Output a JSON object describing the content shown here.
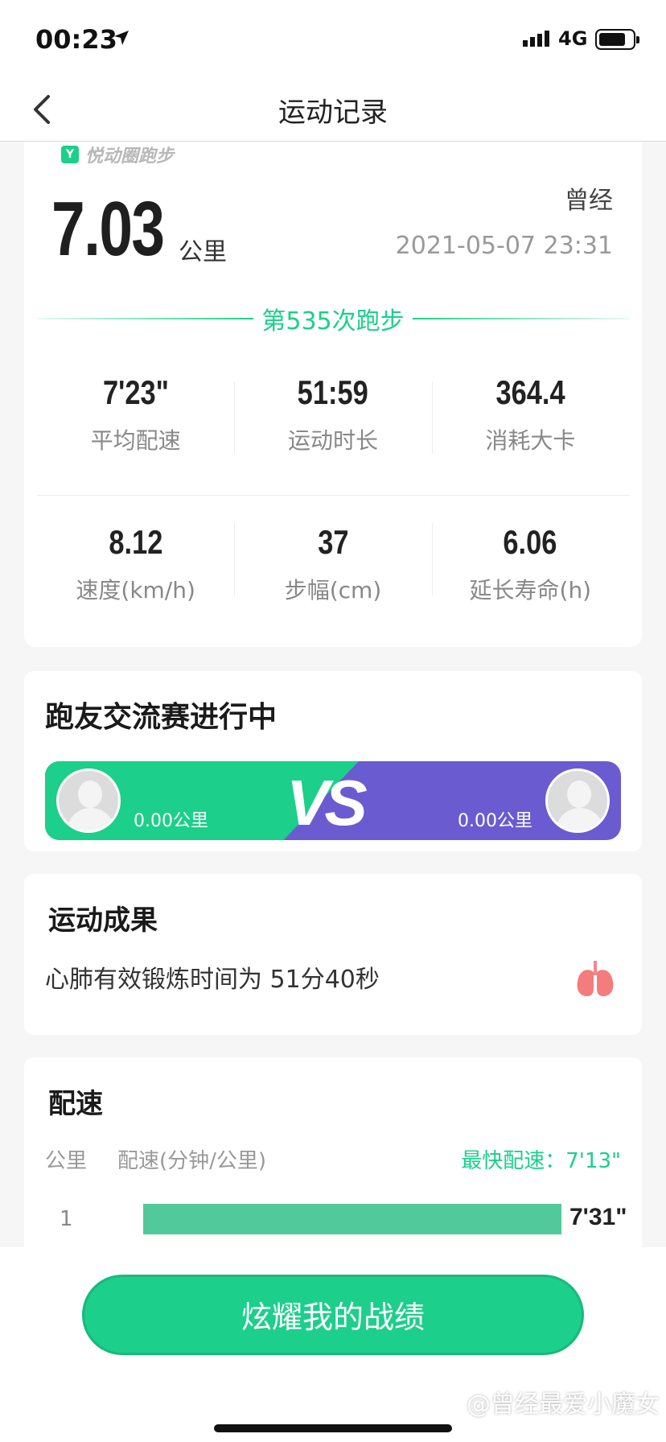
{
  "status_bar": {
    "time": "00:23",
    "network": "4G"
  },
  "nav": {
    "title": "运动记录"
  },
  "summary": {
    "brand": "悦动圈跑步",
    "nickname": "曾经",
    "distance": "7.03",
    "distance_unit": "公里",
    "datetime": "2021-05-07 23:31",
    "run_count_label": "第535次跑步",
    "stats": [
      {
        "value": "7'23\"",
        "label": "平均配速"
      },
      {
        "value": "51:59",
        "label": "运动时长"
      },
      {
        "value": "364.4",
        "label": "消耗大卡"
      },
      {
        "value": "8.12",
        "label": "速度(km/h)"
      },
      {
        "value": "37",
        "label": "步幅(cm)"
      },
      {
        "value": "6.06",
        "label": "延长寿命(h)"
      }
    ]
  },
  "match": {
    "title": "跑友交流赛进行中",
    "vs": "VS",
    "left_distance": "0.00公里",
    "right_distance": "0.00公里"
  },
  "result": {
    "title": "运动成果",
    "text": "心肺有效锻炼时间为 51分40秒"
  },
  "pace": {
    "title": "配速",
    "col_km": "公里",
    "col_pace": "配速(分钟/公里)",
    "fastest": "最快配速：7'13\"",
    "rows": [
      {
        "km": "1",
        "pace": "7'31\""
      }
    ]
  },
  "share_button": "炫耀我的战绩",
  "watermark": "@曾经最爱小魔女",
  "colors": {
    "accent": "#1ccf8b",
    "opponent": "#6a5bd0"
  }
}
